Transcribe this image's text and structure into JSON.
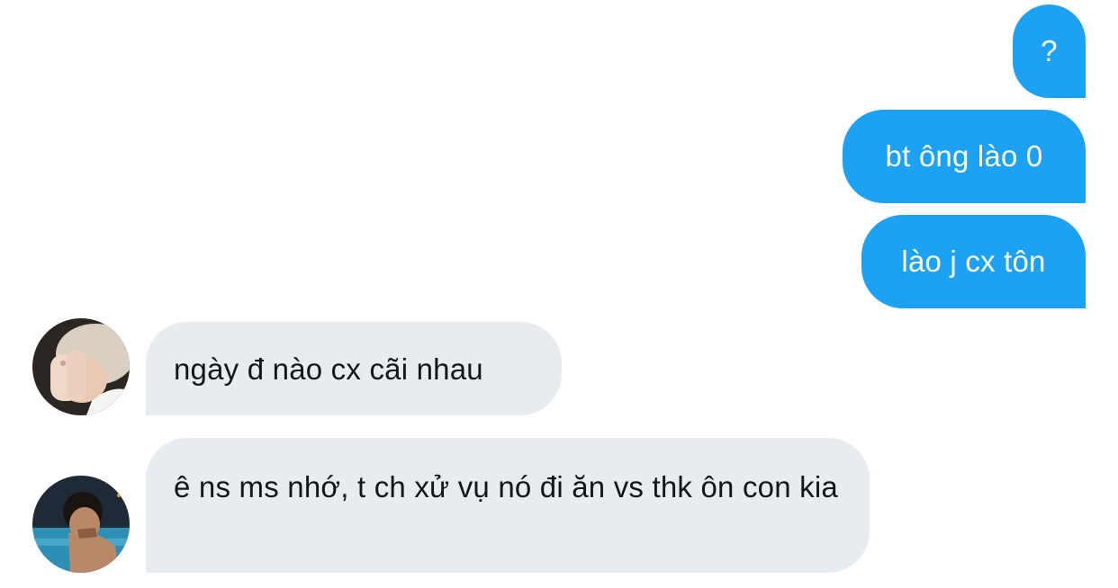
{
  "conversation": {
    "sent_messages": [
      {
        "text": "?"
      },
      {
        "text": "bt ông lào 0"
      },
      {
        "text": "lào j cx tôn"
      }
    ],
    "received_messages": [
      {
        "text": "ngày đ nào cx cãi nhau",
        "avatar_icon": "user-avatar-icon"
      },
      {
        "text": "ê ns ms nhớ, t ch xử vụ nó đi ăn vs thk ôn con kia",
        "avatar_icon": "user-avatar-icon"
      }
    ]
  },
  "colors": {
    "sent_bubble": "#1da1f2",
    "received_bubble": "#e6ecf0",
    "sent_text": "#ffffff",
    "received_text": "#14171a"
  }
}
